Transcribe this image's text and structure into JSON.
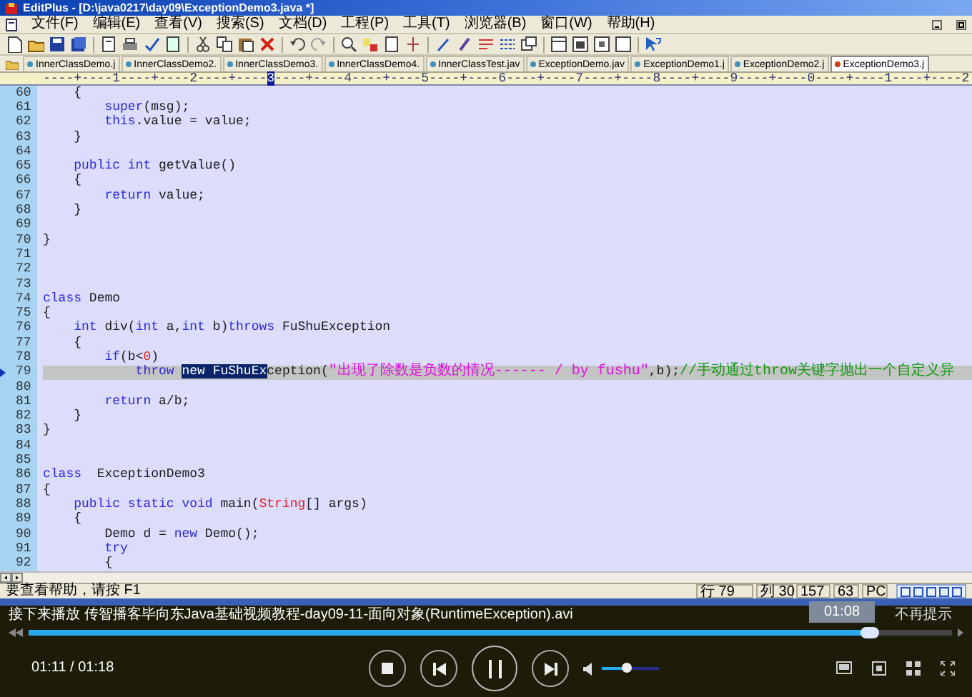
{
  "window": {
    "title": "EditPlus - [D:\\java0217\\day09\\ExceptionDemo3.java *]"
  },
  "menu": [
    "文件(F)",
    "编辑(E)",
    "查看(V)",
    "搜索(S)",
    "文档(D)",
    "工程(P)",
    "工具(T)",
    "浏览器(B)",
    "窗口(W)",
    "帮助(H)"
  ],
  "tabs": [
    {
      "label": "InnerClassDemo.j",
      "selected": false
    },
    {
      "label": "InnerClassDemo2.",
      "selected": false
    },
    {
      "label": "InnerClassDemo3.",
      "selected": false
    },
    {
      "label": "InnerClassDemo4.",
      "selected": false
    },
    {
      "label": "InnerClassTest.jav",
      "selected": false
    },
    {
      "label": "ExceptionDemo.jav",
      "selected": false
    },
    {
      "label": "ExceptionDemo1.j",
      "selected": false
    },
    {
      "label": "ExceptionDemo2.j",
      "selected": false
    },
    {
      "label": "ExceptionDemo3.j",
      "selected": true
    }
  ],
  "ruler": {
    "before": "----+----1----+----2----+----",
    "marker": "3",
    "after": "----+----4----+----5----+----6----+----7----+----8----+----9----+----0----+----1----+----2"
  },
  "code_lines": [
    {
      "number": "60",
      "current": false,
      "segments": [
        {
          "kind": "plain",
          "text": "    {"
        }
      ]
    },
    {
      "number": "61",
      "current": false,
      "segments": [
        {
          "kind": "keyword",
          "text": "        super"
        },
        {
          "kind": "plain",
          "text": "(msg);"
        }
      ]
    },
    {
      "number": "62",
      "current": false,
      "segments": [
        {
          "kind": "keyword",
          "text": "        this"
        },
        {
          "kind": "plain",
          "text": ".value = value;"
        }
      ]
    },
    {
      "number": "63",
      "current": false,
      "segments": [
        {
          "kind": "plain",
          "text": "    }"
        }
      ]
    },
    {
      "number": "64",
      "current": false
    },
    {
      "number": "65",
      "current": false,
      "segments": [
        {
          "kind": "keyword",
          "text": "    public int"
        },
        {
          "kind": "plain",
          "text": " getValue()"
        }
      ]
    },
    {
      "number": "66",
      "current": false,
      "segments": [
        {
          "kind": "plain",
          "text": "    {"
        }
      ]
    },
    {
      "number": "67",
      "current": false,
      "segments": [
        {
          "kind": "keyword",
          "text": "        return"
        },
        {
          "kind": "plain",
          "text": " value;"
        }
      ]
    },
    {
      "number": "68",
      "current": false,
      "segments": [
        {
          "kind": "plain",
          "text": "    }"
        }
      ]
    },
    {
      "number": "69",
      "current": false
    },
    {
      "number": "70",
      "current": false,
      "segments": [
        {
          "kind": "plain",
          "text": "}"
        }
      ]
    },
    {
      "number": "71",
      "current": false
    },
    {
      "number": "72",
      "current": false
    },
    {
      "number": "73",
      "current": false
    },
    {
      "number": "74",
      "current": false,
      "segments": [
        {
          "kind": "keyword",
          "text": "class"
        },
        {
          "kind": "plain",
          "text": " Demo"
        }
      ]
    },
    {
      "number": "75",
      "current": false,
      "segments": [
        {
          "kind": "plain",
          "text": "{"
        }
      ]
    },
    {
      "number": "76",
      "current": false,
      "segments": [
        {
          "kind": "keyword",
          "text": "    int"
        },
        {
          "kind": "plain",
          "text": " div("
        },
        {
          "kind": "keyword",
          "text": "int"
        },
        {
          "kind": "plain",
          "text": " a,"
        },
        {
          "kind": "keyword",
          "text": "int"
        },
        {
          "kind": "plain",
          "text": " b)"
        },
        {
          "kind": "keyword",
          "text": "throws"
        },
        {
          "kind": "plain",
          "text": " FuShuException"
        }
      ]
    },
    {
      "number": "77",
      "current": false,
      "segments": [
        {
          "kind": "plain",
          "text": "    {"
        }
      ]
    },
    {
      "number": "78",
      "current": false,
      "segments": [
        {
          "kind": "keyword",
          "text": "        if"
        },
        {
          "kind": "plain",
          "text": "(b<"
        },
        {
          "kind": "number",
          "text": "0"
        },
        {
          "kind": "plain",
          "text": ")"
        }
      ]
    },
    {
      "number": "79",
      "current": true,
      "segments": [
        {
          "kind": "keyword",
          "text": "            throw "
        },
        {
          "kind": "selection",
          "text": "new FuShuEx"
        },
        {
          "kind": "plain",
          "text": "ception("
        },
        {
          "kind": "string",
          "text": "\"出现了除数是负数的情况------ / by fushu\""
        },
        {
          "kind": "plain",
          "text": ",b);"
        },
        {
          "kind": "comment",
          "text": "//手动通过throw关键字抛出一个自定义异"
        }
      ]
    },
    {
      "number": "80",
      "current": false
    },
    {
      "number": "81",
      "current": false,
      "segments": [
        {
          "kind": "keyword",
          "text": "        return"
        },
        {
          "kind": "plain",
          "text": " a/b;"
        }
      ]
    },
    {
      "number": "82",
      "current": false,
      "segments": [
        {
          "kind": "plain",
          "text": "    }"
        }
      ]
    },
    {
      "number": "83",
      "current": false,
      "segments": [
        {
          "kind": "plain",
          "text": "}"
        }
      ]
    },
    {
      "number": "84",
      "current": false
    },
    {
      "number": "85",
      "current": false
    },
    {
      "number": "86",
      "current": false,
      "segments": [
        {
          "kind": "keyword",
          "text": "class"
        },
        {
          "kind": "plain",
          "text": "  ExceptionDemo3"
        }
      ]
    },
    {
      "number": "87",
      "current": false,
      "segments": [
        {
          "kind": "plain",
          "text": "{"
        }
      ]
    },
    {
      "number": "88",
      "current": false,
      "segments": [
        {
          "kind": "keyword",
          "text": "    public static void"
        },
        {
          "kind": "plain",
          "text": " main("
        },
        {
          "kind": "type",
          "text": "String"
        },
        {
          "kind": "plain",
          "text": "[] args)"
        }
      ]
    },
    {
      "number": "89",
      "current": false,
      "segments": [
        {
          "kind": "plain",
          "text": "    {"
        }
      ]
    },
    {
      "number": "90",
      "current": false,
      "segments": [
        {
          "kind": "plain",
          "text": "        Demo d = "
        },
        {
          "kind": "keyword",
          "text": "new"
        },
        {
          "kind": "plain",
          "text": " Demo();"
        }
      ]
    },
    {
      "number": "91",
      "current": false,
      "segments": [
        {
          "kind": "keyword",
          "text": "        try"
        }
      ]
    },
    {
      "number": "92",
      "current": false,
      "segments": [
        {
          "kind": "plain",
          "text": "        {"
        }
      ]
    }
  ],
  "status_bar": {
    "help": "要查看帮助，请按 F1",
    "line": "行 79",
    "column": "列 30",
    "field_3": "157",
    "field_4": "63",
    "mode": "PC"
  },
  "player": {
    "next_up": "接下来播放 传智播客毕向东Java基础视频教程-day09-11-面向对象(RuntimeException).avi",
    "dismiss": "不再提示",
    "tooltip": "01:08",
    "progress": {
      "level": 0.91
    },
    "time": "01:11 / 01:18",
    "volume": {
      "level": 0.42
    }
  }
}
